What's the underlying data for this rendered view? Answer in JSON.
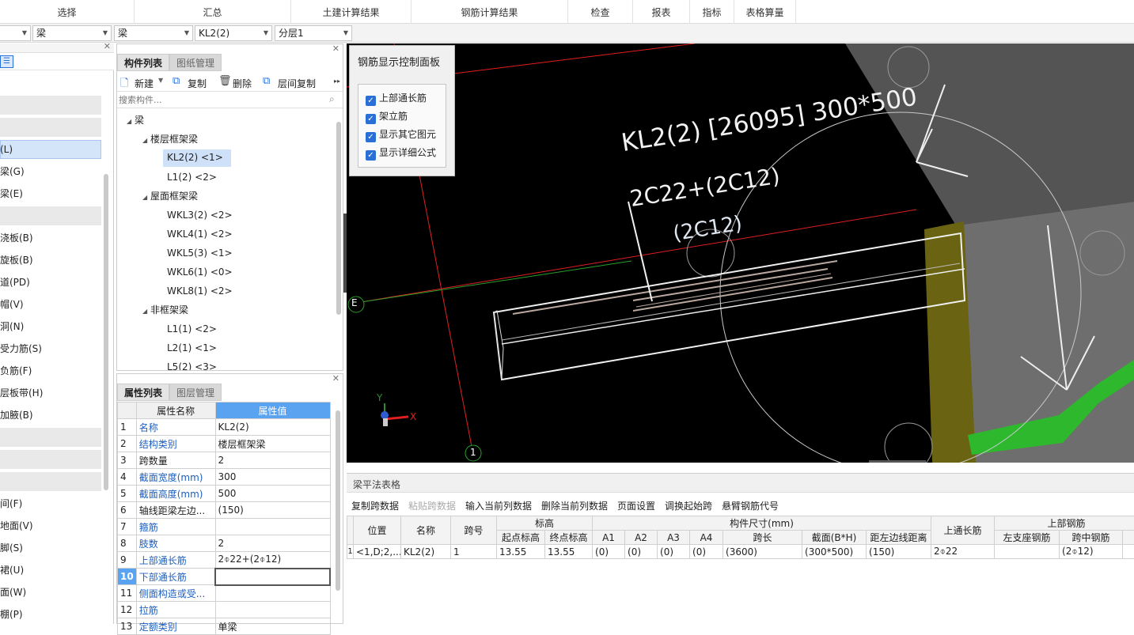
{
  "ribbon": {
    "groups": [
      "选择",
      "汇总",
      "土建计算结果",
      "钢筋计算结果",
      "检查",
      "报表",
      "指标",
      "表格算量"
    ]
  },
  "selectors": {
    "s0": "",
    "s1": "梁",
    "s2": "梁",
    "s3": "KL2(2)",
    "s4": "分层1"
  },
  "left_nav": {
    "items": [
      "(L)",
      "梁(G)",
      "梁(E)",
      "浇板(B)",
      "旋板(B)",
      "道(PD)",
      "帽(V)",
      "洞(N)",
      "受力筋(S)",
      "负筋(F)",
      "层板带(H)",
      "加腋(B)",
      "间(F)",
      "地面(V)",
      "脚(S)",
      "裙(U)",
      "面(W)",
      "棚(P)"
    ]
  },
  "comp_panel": {
    "tabs": [
      "构件列表",
      "图纸管理"
    ],
    "toolbar": {
      "new": "新建",
      "copy": "复制",
      "delete": "删除",
      "floor_copy": "层间复制"
    },
    "search_placeholder": "搜索构件...",
    "tree": {
      "root": "梁",
      "groups": [
        {
          "label": "楼层框架梁",
          "items": [
            "KL2(2)  <1>",
            "L1(2)  <2>"
          ]
        },
        {
          "label": "屋面框架梁",
          "items": [
            "WKL3(2)  <2>",
            "WKL4(1)  <2>",
            "WKL5(3)  <1>",
            "WKL6(1)  <0>",
            "WKL8(1)  <2>"
          ]
        },
        {
          "label": "非框架梁",
          "items": [
            "L1(1)  <2>",
            "L2(1)  <1>",
            "L5(2)  <3>"
          ]
        }
      ]
    }
  },
  "prop_panel": {
    "tabs": [
      "属性列表",
      "图层管理"
    ],
    "header": {
      "name": "属性名称",
      "value": "属性值"
    },
    "rows": [
      {
        "n": "1",
        "name": "名称",
        "value": "KL2(2)"
      },
      {
        "n": "2",
        "name": "结构类别",
        "value": "楼层框架梁"
      },
      {
        "n": "3",
        "name": "跨数量",
        "value": "2"
      },
      {
        "n": "4",
        "name": "截面宽度(mm)",
        "value": "300"
      },
      {
        "n": "5",
        "name": "截面高度(mm)",
        "value": "500"
      },
      {
        "n": "6",
        "name": "轴线距梁左边...",
        "value": "(150)"
      },
      {
        "n": "7",
        "name": "箍筋",
        "value": ""
      },
      {
        "n": "8",
        "name": "肢数",
        "value": "2"
      },
      {
        "n": "9",
        "name": "上部通长筋",
        "value": "2⌽22+(2⌽12)"
      },
      {
        "n": "10",
        "name": "下部通长筋",
        "value": ""
      },
      {
        "n": "11",
        "name": "侧面构造或受...",
        "value": ""
      },
      {
        "n": "12",
        "name": "拉筋",
        "value": ""
      },
      {
        "n": "13",
        "name": "定额类别",
        "value": "单梁"
      }
    ]
  },
  "control_panel": {
    "title": "钢筋显示控制面板",
    "checkboxes": [
      {
        "label": "上部通长筋",
        "checked": true
      },
      {
        "label": "架立筋",
        "checked": true
      },
      {
        "label": "显示其它图元",
        "checked": true
      },
      {
        "label": "显示详细公式",
        "checked": true
      }
    ]
  },
  "viewport": {
    "label_line1": "KL2(2) [26095] 300*500",
    "label_line2": "2C22+(2C12)",
    "label_line3": "(2C12)",
    "axis_e": "E",
    "axis_1": "1",
    "axis_x": "X",
    "axis_y": "Y"
  },
  "bottom": {
    "title": "梁平法表格",
    "toolbar": [
      "复制跨数据",
      "粘贴跨数据",
      "输入当前列数据",
      "删除当前列数据",
      "页面设置",
      "调换起始跨",
      "悬臂钢筋代号"
    ],
    "header_top": {
      "pos": "位置",
      "name": "名称",
      "span": "跨号",
      "elev": "标高",
      "dims": "构件尺寸(mm)",
      "top_long": "上通长筋",
      "top_steel": "上部钢筋"
    },
    "header_sub": [
      "起点标高",
      "终点标高",
      "A1",
      "A2",
      "A3",
      "A4",
      "跨长",
      "截面(B*H)",
      "距左边线距离",
      "左支座钢筋",
      "跨中钢筋"
    ],
    "row": {
      "idx": "1",
      "pos": "<1,D;2,...",
      "name": "KL2(2)",
      "span": "1",
      "start": "13.55",
      "end": "13.55",
      "a1": "(0)",
      "a2": "(0)",
      "a3": "(0)",
      "a4": "(0)",
      "len": "(3600)",
      "sec": "(300*500)",
      "dist": "(150)",
      "top_long": "2⌽22",
      "left_sup": "",
      "mid": "(2⌽12)"
    }
  }
}
